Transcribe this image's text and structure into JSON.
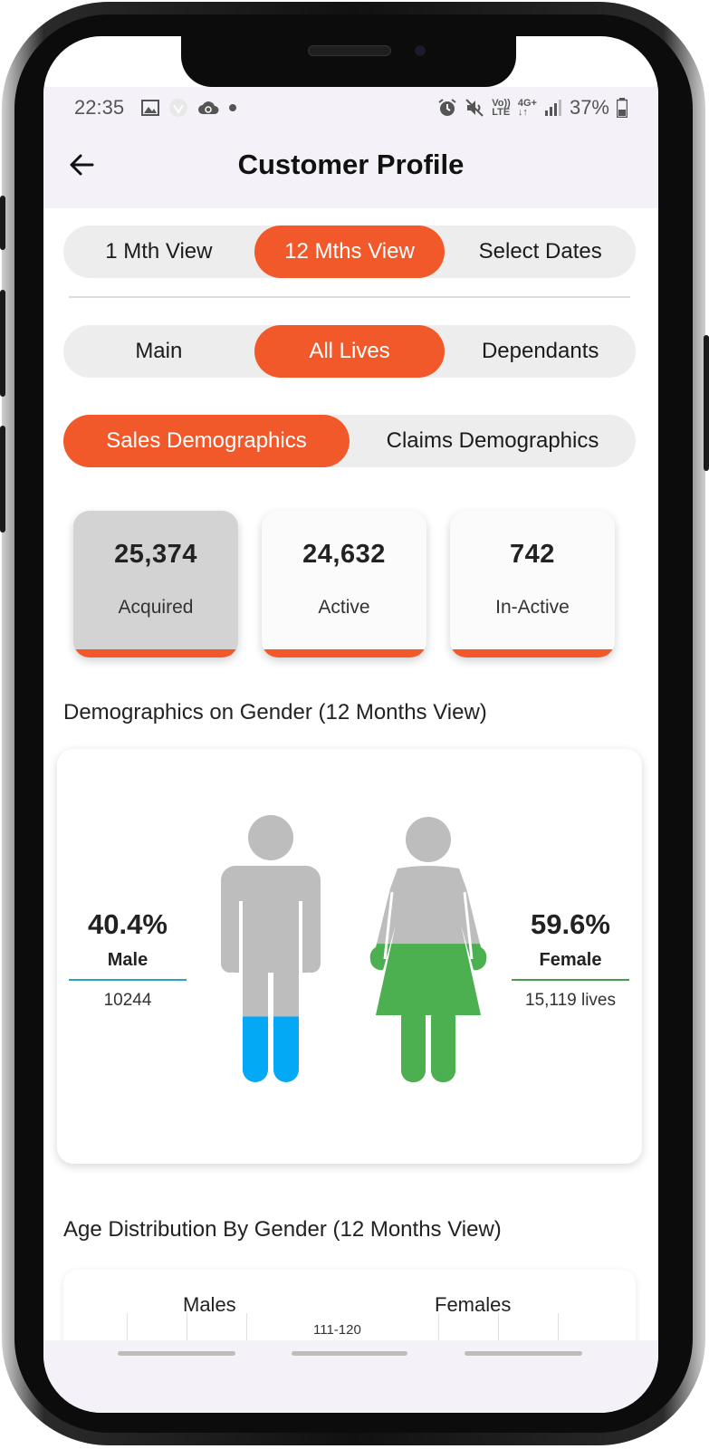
{
  "status_bar": {
    "time": "22:35",
    "battery": "37%",
    "network_labels": [
      "Vo)) LTE",
      "4G+"
    ]
  },
  "app_bar": {
    "title": "Customer Profile",
    "back_icon": "arrow-left-icon"
  },
  "period_tabs": [
    "1 Mth View",
    "12 Mths View",
    "Select Dates"
  ],
  "period_active": "12 Mths View",
  "member_tabs": [
    "Main",
    "All Lives",
    "Dependants"
  ],
  "member_active": "All Lives",
  "demo_tabs": [
    "Sales Demographics",
    "Claims Demographics"
  ],
  "demo_active": "Sales Demographics",
  "stats": [
    {
      "value": "25,374",
      "label": "Acquired",
      "selected": true
    },
    {
      "value": "24,632",
      "label": "Active",
      "selected": false
    },
    {
      "value": "742",
      "label": "In-Active",
      "selected": false
    }
  ],
  "gender_section": {
    "title": "Demographics on Gender (12 Months View)",
    "male": {
      "percent": "40.4%",
      "label": "Male",
      "count": "10244",
      "fill_fraction": 0.404,
      "color": "#03a9f4"
    },
    "female": {
      "percent": "59.6%",
      "label": "Female",
      "count": "15,119 lives",
      "fill_fraction": 0.596,
      "color": "#4caf50"
    }
  },
  "age_section": {
    "title": "Age Distribution By Gender (12 Months View)",
    "males_label": "Males",
    "females_label": "Females",
    "first_band": "111-120"
  },
  "colors": {
    "accent": "#f1592a",
    "figure_base": "#bdbdbd",
    "segment_bg": "#ededed"
  }
}
